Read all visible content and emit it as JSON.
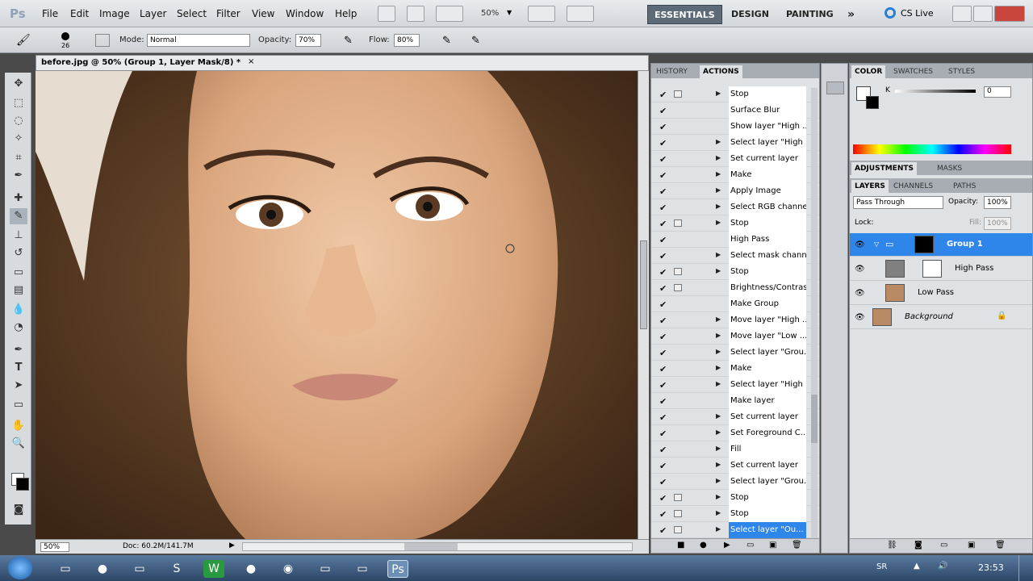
{
  "app": {
    "logo": "Ps"
  },
  "menu": [
    "File",
    "Edit",
    "Image",
    "Layer",
    "Select",
    "Filter",
    "View",
    "Window",
    "Help"
  ],
  "zoom_select": "50%",
  "workspaces": {
    "essentials": "ESSENTIALS",
    "design": "DESIGN",
    "painting": "PAINTING",
    "more": "»",
    "cslive": "CS Live"
  },
  "options": {
    "brush_size": "26",
    "mode_label": "Mode:",
    "mode_value": "Normal",
    "opacity_label": "Opacity:",
    "opacity_value": "70%",
    "flow_label": "Flow:",
    "flow_value": "80%"
  },
  "document": {
    "tab_title": "before.jpg @ 50% (Group 1, Layer Mask/8) *",
    "zoom": "50%",
    "doc_size": "Doc: 60.2M/141.7M"
  },
  "actions_panel": {
    "tabs": [
      "HISTORY",
      "ACTIONS"
    ],
    "rows": [
      {
        "label": "Stop",
        "tri": true,
        "dlg": true
      },
      {
        "label": "Surface Blur",
        "tri": false,
        "dlg": false
      },
      {
        "label": "Show layer \"High ...",
        "tri": false,
        "dlg": false
      },
      {
        "label": "Select layer \"High ...",
        "tri": true,
        "dlg": false
      },
      {
        "label": "Set current layer",
        "tri": true,
        "dlg": false
      },
      {
        "label": "Make",
        "tri": true,
        "dlg": false
      },
      {
        "label": "Apply Image",
        "tri": true,
        "dlg": false
      },
      {
        "label": "Select RGB channel",
        "tri": true,
        "dlg": false
      },
      {
        "label": "Stop",
        "tri": true,
        "dlg": true
      },
      {
        "label": "High Pass",
        "tri": false,
        "dlg": false
      },
      {
        "label": "Select mask channel",
        "tri": true,
        "dlg": false
      },
      {
        "label": "Stop",
        "tri": true,
        "dlg": true
      },
      {
        "label": "Brightness/Contrast",
        "tri": false,
        "dlg": true
      },
      {
        "label": "Make Group",
        "tri": false,
        "dlg": false
      },
      {
        "label": "Move layer \"High ...",
        "tri": true,
        "dlg": false
      },
      {
        "label": "Move layer \"Low ...",
        "tri": true,
        "dlg": false
      },
      {
        "label": "Select layer \"Grou...",
        "tri": true,
        "dlg": false
      },
      {
        "label": "Make",
        "tri": true,
        "dlg": false
      },
      {
        "label": "Select layer \"High ...",
        "tri": true,
        "dlg": false
      },
      {
        "label": "Make layer",
        "tri": false,
        "dlg": false
      },
      {
        "label": "Set current layer",
        "tri": true,
        "dlg": false
      },
      {
        "label": "Set Foreground C...",
        "tri": true,
        "dlg": false
      },
      {
        "label": "Fill",
        "tri": true,
        "dlg": false
      },
      {
        "label": "Set current layer",
        "tri": true,
        "dlg": false
      },
      {
        "label": "Select layer \"Grou...",
        "tri": true,
        "dlg": false
      },
      {
        "label": "Stop",
        "tri": true,
        "dlg": true
      },
      {
        "label": "Stop",
        "tri": true,
        "dlg": true
      },
      {
        "label": "Select layer \"Ou...",
        "tri": true,
        "dlg": true
      }
    ]
  },
  "color_panel": {
    "tabs": [
      "COLOR",
      "SWATCHES",
      "STYLES"
    ],
    "k_label": "K",
    "k_value": "0"
  },
  "adjust_tabs": [
    "ADJUSTMENTS",
    "MASKS"
  ],
  "layers_panel": {
    "tabs": [
      "LAYERS",
      "CHANNELS",
      "PATHS"
    ],
    "blend": "Pass Through",
    "opacity_label": "Opacity:",
    "opacity_value": "100%",
    "lock_label": "Lock:",
    "fill_label": "Fill:",
    "fill_value": "100%",
    "layers": [
      {
        "name": "Group 1"
      },
      {
        "name": "High Pass"
      },
      {
        "name": "Low Pass"
      },
      {
        "name": "Background"
      }
    ]
  },
  "taskbar": {
    "lang": "SR",
    "time": "23:53"
  }
}
